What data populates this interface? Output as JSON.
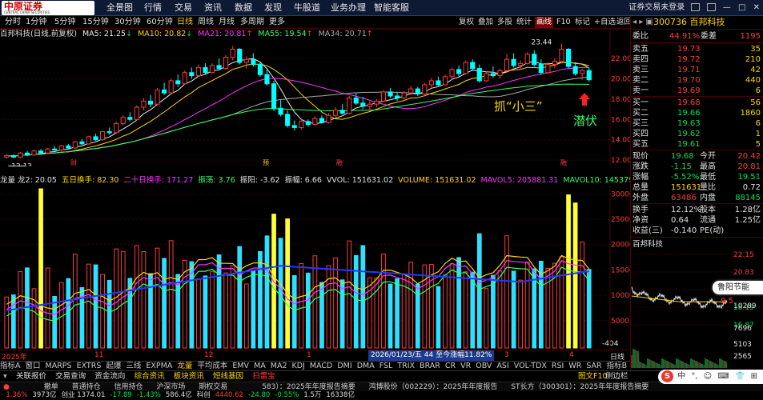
{
  "topbar": {
    "menus": [
      "全景图",
      "行情",
      "交易",
      "资讯",
      "数据",
      "发现",
      "牛股道",
      "业务办理",
      "智能客服"
    ],
    "status": "证券交易未登录",
    "window_btns": [
      "—",
      "□",
      "✕"
    ],
    "logo_text": "中原证券",
    "logo_en": "CENTRAL CHINA SECURITIES"
  },
  "periods": [
    "分时",
    "1分钟",
    "5分钟",
    "15分钟",
    "30分钟",
    "60分钟",
    "日线",
    "周线",
    "月线",
    "多周期",
    "更多"
  ],
  "tools": [
    "复权",
    "叠加",
    "多股",
    "统计",
    "画线",
    "F10",
    "标记",
    "+自选",
    "返回"
  ],
  "stock_title": "百邦科技(日线,前复权)",
  "ma": [
    {
      "label": "MA5: 21.25",
      "arrow": "↓",
      "color": "#e8e8e8"
    },
    {
      "label": "MA10: 20.82",
      "arrow": "↓",
      "color": "#ffd400"
    },
    {
      "label": "MA21: 20.81",
      "arrow": "↑",
      "color": "#ff33ff"
    },
    {
      "label": "MA55: 19.54",
      "arrow": "↑",
      "color": "#33ff66"
    },
    {
      "label": "MA34: 20.71",
      "arrow": "↑",
      "color": "#aaaaaa"
    }
  ],
  "chart_data": {
    "type": "candlestick",
    "title": "百邦科技(日线,前复权)",
    "y_ticks": [
      22.0,
      20.0,
      18.0,
      16.0,
      14.0,
      12.0
    ],
    "ylim": [
      11.7,
      23.8
    ],
    "high_label": "23.44",
    "low_label": "12.13",
    "candles": [
      [
        12.3,
        12.6,
        12.13,
        12.45
      ],
      [
        12.45,
        12.55,
        12.2,
        12.3
      ],
      [
        12.3,
        12.8,
        12.2,
        12.7
      ],
      [
        12.7,
        12.9,
        12.4,
        12.5
      ],
      [
        12.5,
        13.0,
        12.45,
        12.9
      ],
      [
        12.9,
        13.1,
        12.6,
        12.7
      ],
      [
        12.7,
        13.2,
        12.6,
        13.1
      ],
      [
        13.1,
        13.4,
        12.9,
        13.0
      ],
      [
        13.0,
        13.5,
        12.9,
        13.4
      ],
      [
        13.4,
        13.6,
        13.1,
        13.2
      ],
      [
        13.2,
        13.9,
        13.1,
        13.8
      ],
      [
        13.8,
        14.1,
        13.5,
        13.6
      ],
      [
        13.6,
        14.4,
        13.5,
        14.3
      ],
      [
        14.3,
        14.6,
        13.9,
        14.0
      ],
      [
        14.0,
        14.9,
        13.9,
        14.8
      ],
      [
        14.8,
        15.2,
        14.5,
        14.7
      ],
      [
        14.7,
        15.8,
        14.6,
        15.6
      ],
      [
        15.6,
        16.4,
        15.4,
        16.2
      ],
      [
        16.2,
        16.7,
        15.8,
        16.0
      ],
      [
        16.0,
        17.4,
        15.9,
        17.2
      ],
      [
        17.2,
        18.1,
        16.9,
        17.8
      ],
      [
        17.8,
        18.4,
        17.2,
        17.5
      ],
      [
        17.5,
        19.1,
        17.4,
        18.9
      ],
      [
        18.9,
        19.6,
        18.4,
        18.6
      ],
      [
        18.6,
        20.0,
        18.5,
        19.8
      ],
      [
        19.8,
        20.4,
        19.2,
        19.5
      ],
      [
        19.5,
        20.8,
        19.4,
        20.6
      ],
      [
        20.6,
        21.1,
        20.0,
        20.3
      ],
      [
        20.3,
        21.4,
        20.1,
        21.1
      ],
      [
        21.1,
        21.5,
        20.4,
        20.6
      ],
      [
        20.6,
        21.5,
        20.5,
        21.3
      ],
      [
        21.3,
        22.0,
        20.8,
        21.0
      ],
      [
        21.0,
        22.3,
        20.9,
        22.1
      ],
      [
        22.1,
        23.2,
        21.8,
        22.9
      ],
      [
        22.9,
        23.0,
        21.4,
        21.6
      ],
      [
        21.6,
        22.2,
        21.0,
        21.9
      ],
      [
        21.9,
        22.5,
        21.2,
        21.4
      ],
      [
        21.4,
        21.7,
        20.2,
        20.4
      ],
      [
        20.4,
        20.9,
        19.3,
        19.5
      ],
      [
        19.5,
        19.8,
        16.8,
        17.1
      ],
      [
        17.1,
        17.9,
        16.3,
        16.5
      ],
      [
        16.5,
        16.9,
        15.2,
        15.4
      ],
      [
        15.4,
        15.9,
        14.9,
        15.2
      ],
      [
        15.2,
        16.1,
        15.0,
        15.8
      ],
      [
        15.8,
        16.0,
        15.3,
        15.5
      ],
      [
        15.5,
        16.3,
        15.4,
        16.1
      ],
      [
        16.1,
        16.4,
        15.6,
        15.7
      ],
      [
        15.7,
        16.6,
        15.6,
        16.4
      ],
      [
        16.4,
        17.2,
        16.2,
        16.9
      ],
      [
        16.9,
        17.5,
        16.5,
        16.6
      ],
      [
        16.6,
        18.3,
        16.5,
        18.1
      ],
      [
        18.1,
        18.6,
        17.4,
        17.6
      ],
      [
        17.6,
        18.2,
        17.0,
        17.3
      ],
      [
        17.3,
        17.8,
        16.8,
        17.5
      ],
      [
        17.5,
        18.0,
        17.2,
        17.8
      ],
      [
        17.8,
        18.9,
        17.7,
        18.7
      ],
      [
        18.7,
        19.1,
        18.1,
        18.3
      ],
      [
        18.3,
        18.7,
        17.8,
        18.1
      ],
      [
        18.1,
        18.8,
        18.0,
        18.6
      ],
      [
        18.6,
        19.3,
        18.4,
        19.0
      ],
      [
        19.0,
        19.2,
        18.3,
        18.5
      ],
      [
        18.5,
        19.6,
        18.4,
        19.4
      ],
      [
        19.4,
        20.1,
        19.1,
        19.8
      ],
      [
        19.8,
        20.2,
        19.2,
        19.4
      ],
      [
        19.4,
        20.4,
        19.3,
        20.2
      ],
      [
        20.2,
        21.1,
        19.9,
        20.9
      ],
      [
        20.9,
        21.3,
        20.2,
        20.5
      ],
      [
        20.5,
        21.8,
        20.4,
        21.6
      ],
      [
        21.6,
        21.9,
        20.8,
        21.0
      ],
      [
        21.0,
        21.4,
        19.6,
        19.8
      ],
      [
        19.8,
        20.7,
        19.7,
        20.5
      ],
      [
        20.5,
        21.2,
        20.1,
        20.3
      ],
      [
        20.3,
        21.0,
        20.0,
        20.8
      ],
      [
        20.8,
        22.4,
        20.6,
        21.9
      ],
      [
        21.9,
        22.5,
        21.1,
        21.3
      ],
      [
        21.3,
        21.8,
        20.9,
        21.5
      ],
      [
        21.5,
        22.6,
        21.4,
        22.4
      ],
      [
        22.4,
        22.8,
        21.2,
        21.4
      ],
      [
        21.4,
        21.9,
        20.4,
        20.6
      ],
      [
        20.6,
        21.6,
        20.5,
        21.4
      ],
      [
        21.4,
        22.0,
        21.0,
        21.7
      ],
      [
        21.7,
        23.44,
        21.5,
        22.9
      ],
      [
        22.9,
        23.0,
        21.0,
        21.2
      ],
      [
        21.2,
        21.6,
        20.3,
        20.5
      ],
      [
        20.5,
        21.0,
        19.9,
        20.8
      ],
      [
        20.8,
        21.1,
        19.7,
        19.9
      ]
    ],
    "annotation_main": "抓“小三”",
    "annotation_sub": "潜伏"
  },
  "markers": [
    "财",
    "预",
    "融",
    "融"
  ],
  "ind_line": [
    {
      "t": "龙量 龙2: 20.05",
      "c": "#e0e0e0"
    },
    {
      "t": "五日换手: 82.30",
      "c": "#ffd400"
    },
    {
      "t": "二十日换手: 171.27",
      "c": "#ff33ff"
    },
    {
      "t": "振荡: 3.76",
      "c": "#33ff66"
    },
    {
      "t": "振阳: -3.62",
      "c": "#e0e0e0"
    },
    {
      "t": "振幅: 6.66",
      "c": "#e0e0e0"
    },
    {
      "t": "VVOL: 151631.02",
      "c": "#e0e0e0"
    },
    {
      "t": "VOLUME: 151631.02",
      "c": "#ffd400"
    },
    {
      "t": "MAVOL5: 205881.31",
      "c": "#ff33ff"
    },
    {
      "t": "MAVOL10: 145379.48",
      "c": "#33ff66"
    }
  ],
  "vol_chart": {
    "y_ticks": [
      "30000",
      "25000",
      "20000",
      "15000",
      "10000",
      "5000",
      "-404"
    ],
    "vol_ylim": [
      -404,
      31000
    ]
  },
  "date_labels": [
    "2025年",
    "11",
    "12",
    "1",
    "2",
    "3",
    "4",
    "日线"
  ],
  "date_tooltip": "2026/01/23/五 44 至今涨幅11.82%",
  "tabs1": [
    "指标A",
    "窗口",
    "MARPS",
    "EXTRS",
    "起爆",
    "三线",
    "EXPMA",
    "龙量",
    "平均成本",
    "EMV",
    "MA",
    "MA2",
    "KDJ",
    "MACD",
    "DMI",
    "DMA",
    "FSL",
    "TRIX",
    "BRAR",
    "CR",
    "VR",
    "OBV",
    "ASI",
    "VOL-TDX",
    "RSI",
    "WR",
    "SAR",
    "指标B",
    "模板"
  ],
  "tabs2": [
    "关联报价",
    "交易查询",
    "资金流向",
    "综合资讯",
    "板块资讯",
    "短线基因",
    "扫雷宝",
    "期权交易"
  ],
  "tabs2_right": [
    "图文F10",
    "侧边栏"
  ],
  "ticker": [
    "撤单",
    "普通持仓",
    "信用持仓",
    "沪深市场",
    "期权交易",
    "583）：2025年年度报告摘要",
    "鸿博股份（002229）：2025年年度报告",
    "ST长方（300301）：2025年年度报告摘要"
  ],
  "statusbar": [
    {
      "t": "· 1.36%",
      "c": "#ff3b3b"
    },
    {
      "t": "3973亿",
      "c": "#ddd"
    },
    {
      "t": "创业 1374.01",
      "c": "#ddd"
    },
    {
      "t": "-17.89",
      "c": "#00e05a"
    },
    {
      "t": "-1.43%",
      "c": "#00e05a"
    },
    {
      "t": "586.4亿",
      "c": "#ddd"
    },
    {
      "t": "科创",
      "c": "#ddd"
    },
    {
      "t": "4440.62",
      "c": "#ff3b3b"
    },
    {
      "t": "-24.80",
      "c": "#00e05a"
    },
    {
      "t": "-0.55%",
      "c": "#00e05a"
    },
    {
      "t": "1.5万",
      "c": "#ddd"
    },
    {
      "t": "16338亿",
      "c": "#ddd"
    }
  ],
  "quote": {
    "code_name": "300736 百邦科技",
    "webi": "委比",
    "webi_v": "44.91%",
    "wecha": "委差",
    "wecha_v": "1195",
    "asks": [
      [
        "卖五",
        "19.73",
        "35"
      ],
      [
        "卖四",
        "19.72",
        "210"
      ],
      [
        "卖三",
        "19.71",
        "42"
      ],
      [
        "卖二",
        "19.70",
        "440"
      ],
      [
        "卖一",
        "19.69",
        "6"
      ]
    ],
    "bids": [
      [
        "买一",
        "19.68",
        "56"
      ],
      [
        "买二",
        "19.66",
        "1860"
      ],
      [
        "买三",
        "19.63",
        "6"
      ],
      [
        "买四",
        "19.62",
        "1"
      ],
      [
        "买五",
        "19.61",
        "5"
      ]
    ],
    "rows": [
      [
        [
          "现价",
          "19.68",
          "#00e05a"
        ],
        [
          "今开",
          "20.42",
          "#ff3b3b"
        ]
      ],
      [
        [
          "涨跌",
          "-1.15",
          "#00e05a"
        ],
        [
          "最高",
          "20.81",
          "#ff3b3b"
        ]
      ],
      [
        [
          "涨幅",
          "-5.52%",
          "#00e05a"
        ],
        [
          "最低",
          "19.51",
          "#00e05a"
        ]
      ],
      [
        [
          "总量",
          "151631",
          "#ffd400"
        ],
        [
          "量比",
          "0.72",
          "#e0e0e0"
        ]
      ],
      [
        [
          "外盘",
          "63486",
          "#ff3b3b"
        ],
        [
          "内盘",
          "88145",
          "#00e05a"
        ]
      ]
    ],
    "rows2": [
      [
        [
          "换手",
          "12.12%",
          "#e0e0e0"
        ],
        [
          "股本",
          "1.28亿",
          "#e0e0e0"
        ]
      ],
      [
        [
          "净资",
          "0.64",
          "#e0e0e0"
        ],
        [
          "流通",
          "1.25亿",
          "#e0e0e0"
        ]
      ],
      [
        [
          "收益(三)",
          "-0.140",
          "#e0e0e0"
        ],
        [
          "PE(动)",
          "",
          "#e0e0e0"
        ]
      ]
    ],
    "mini_title": "百邦科技",
    "mini_y": [
      "22.15",
      "20.83",
      "19.51",
      "18.19",
      "16.87"
    ],
    "mini_vol": [
      "10289",
      "7696",
      "5103",
      "2565"
    ],
    "tooltip": "鲁阳节能",
    "tooltip_v": "9.5"
  },
  "ime": {
    "items": [
      "中",
      "°,",
      "☺",
      "⌨",
      "👕",
      "⊞"
    ],
    "ai": "Ai"
  }
}
